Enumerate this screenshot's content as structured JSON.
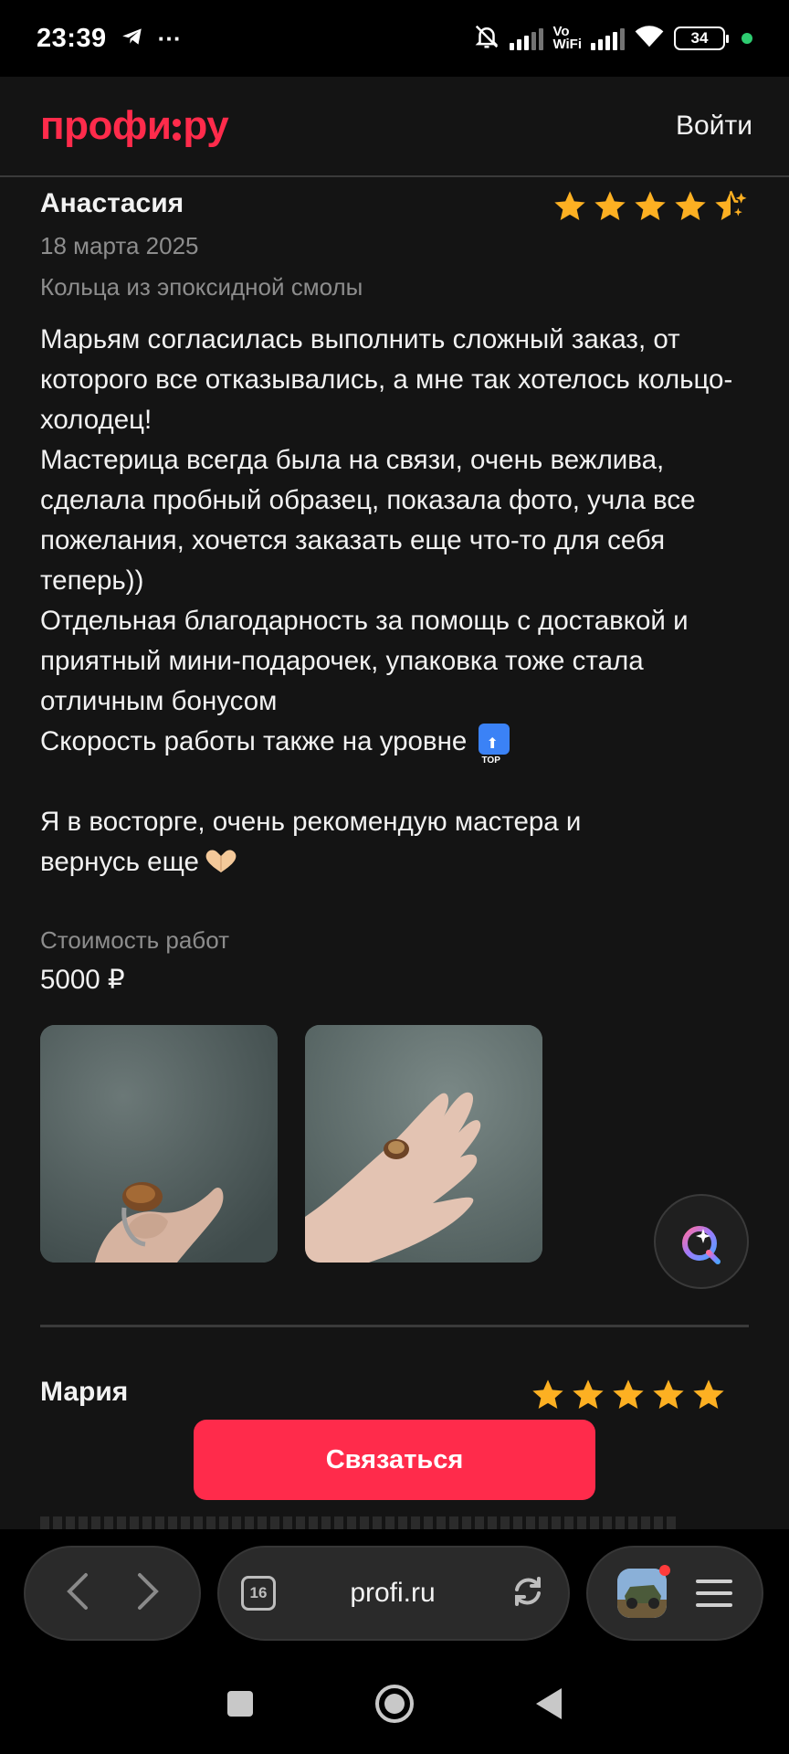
{
  "status_bar": {
    "time": "23:39",
    "more": "···",
    "vowifi_line1": "Vo",
    "vowifi_line2": "WiFi",
    "battery": "34"
  },
  "header": {
    "logo": {
      "part1": "профи",
      "part2": "ру"
    },
    "login_label": "Войти"
  },
  "review1": {
    "author": "Анастасия",
    "rating": 4.5,
    "date": "18 марта 2025",
    "service": "Кольца из эпоксидной смолы",
    "text_main": "Марьям согласилась выполнить сложный заказ, от которого все отказывались, а мне так хотелось кольцо-холодец!\nМастерица всегда была на связи, очень вежлива, сделала пробный образец, показала фото, учла все пожелания, хочется заказать еще что-то для себя теперь))\nОтдельная благодарность за помощь с доставкой и приятный мини-подарочек, упаковка тоже стала отличным бонусом\nСкорость работы также на уровне",
    "text_end_1": "Я в восторге, очень рекомендую мастера и",
    "text_end_2": "вернусь еще",
    "cost_label": "Стоимость работ",
    "cost_value": "5000 ₽",
    "photos": [
      "ring-photo-1",
      "ring-photo-2"
    ]
  },
  "review2": {
    "author": "Мария",
    "rating": 5
  },
  "cta_label": "Связаться",
  "browser": {
    "tabs_count": "16",
    "url": "profi.ru"
  },
  "colors": {
    "brand": "#ff2b4b",
    "star": "#fdb022",
    "background": "#141414",
    "muted_text": "#8d8d8d"
  }
}
